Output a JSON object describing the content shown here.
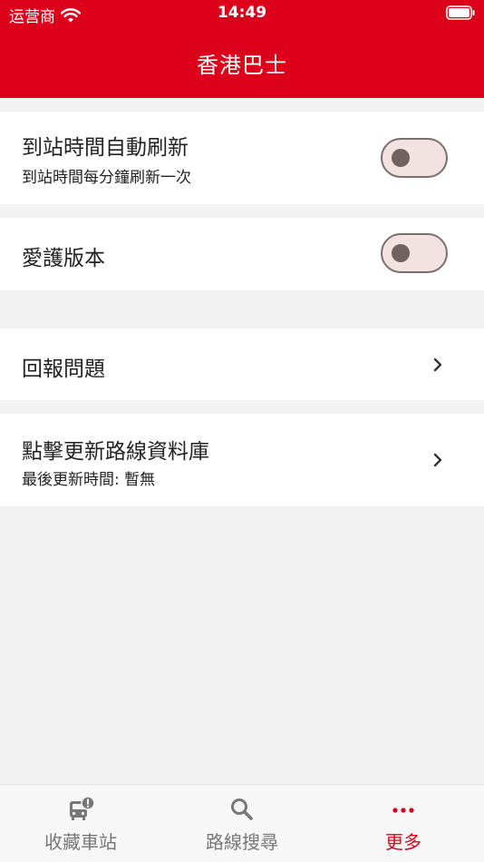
{
  "status_bar": {
    "carrier": "运营商",
    "time": "14:49"
  },
  "header": {
    "title": "香港巴士"
  },
  "settings": {
    "auto_refresh": {
      "label": "到站時間自動刷新",
      "subtitle": "到站時間每分鐘刷新一次",
      "enabled": false
    },
    "lite_version": {
      "label": "愛護版本",
      "enabled": false
    },
    "report_issue": {
      "label": "回報問題"
    },
    "update_database": {
      "label": "點擊更新路線資料庫",
      "subtitle": "最後更新時間: 暫無"
    }
  },
  "tabbar": {
    "tabs": [
      {
        "label": "收藏車站",
        "icon": "bus-stop-icon",
        "active": false
      },
      {
        "label": "路線搜尋",
        "icon": "search-icon",
        "active": false
      },
      {
        "label": "更多",
        "icon": "more-icon",
        "active": true
      }
    ]
  },
  "colors": {
    "brand": "#dd001b",
    "background": "#f2f2f2",
    "inactive_tab": "#777777"
  }
}
